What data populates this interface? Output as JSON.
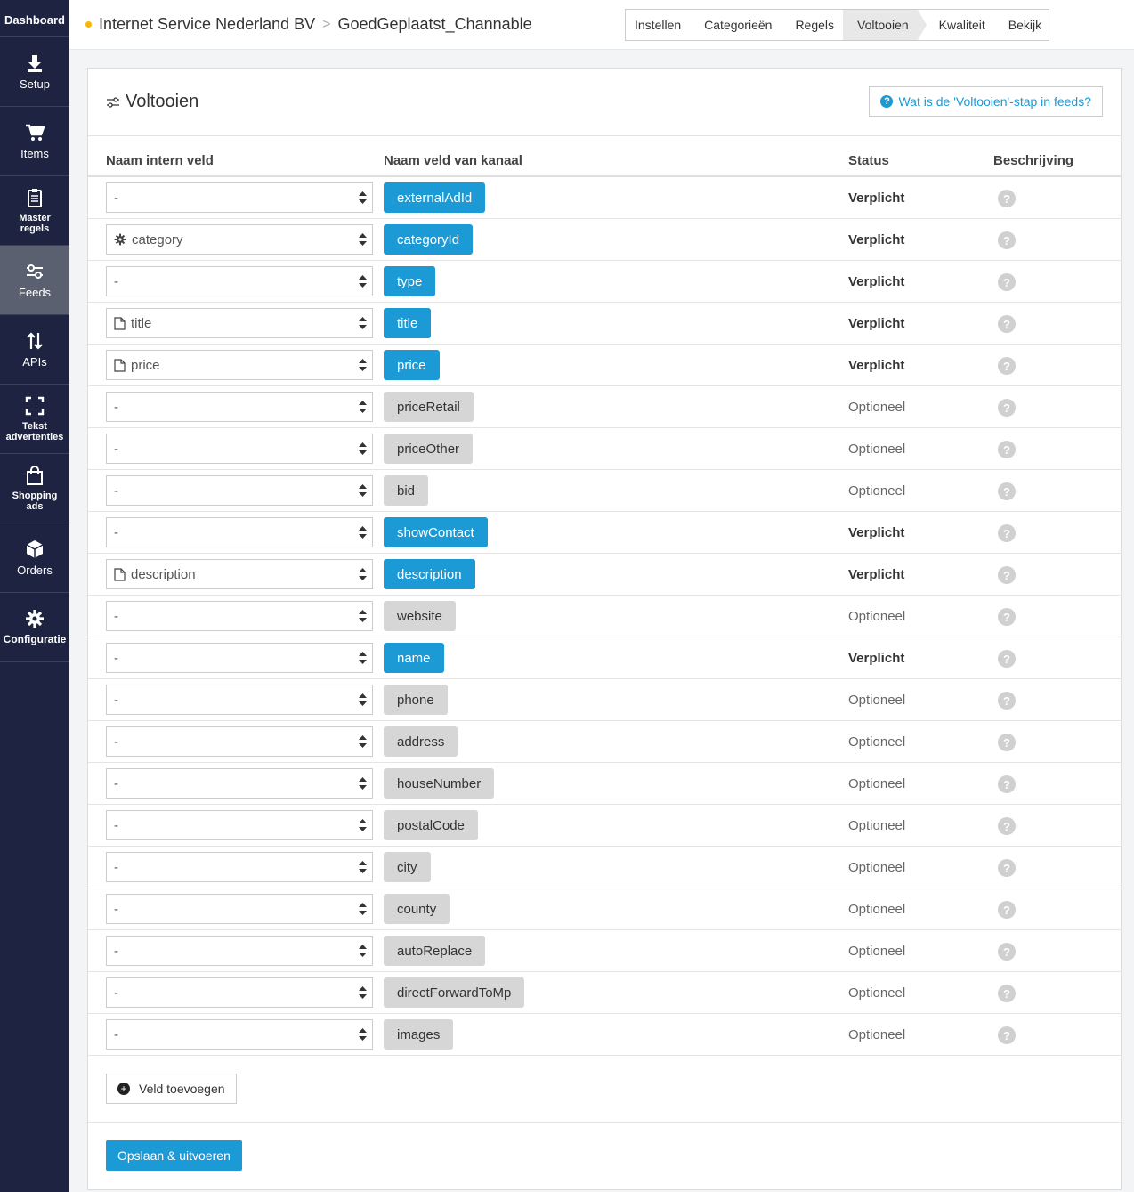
{
  "sidebar": {
    "items": [
      {
        "label": "Dashboard",
        "icon": "dashboard-icon"
      },
      {
        "label": "Setup",
        "icon": "download-icon"
      },
      {
        "label": "Items",
        "icon": "cart-icon"
      },
      {
        "label": "Master regels",
        "icon": "clipboard-icon"
      },
      {
        "label": "Feeds",
        "icon": "sliders-icon"
      },
      {
        "label": "APIs",
        "icon": "swap-icon"
      },
      {
        "label": "Tekst advertenties",
        "icon": "frame-icon"
      },
      {
        "label": "Shopping ads",
        "icon": "bag-icon"
      },
      {
        "label": "Orders",
        "icon": "box-icon"
      },
      {
        "label": "Configuratie",
        "icon": "gear-icon"
      }
    ]
  },
  "header": {
    "company": "Internet Service Nederland BV",
    "separator": ">",
    "feed": "GoedGeplaatst_Channable",
    "steps": [
      "Instellen",
      "Categorieën",
      "Regels",
      "Voltooien",
      "Kwaliteit",
      "Bekijk"
    ],
    "active_step": "Voltooien"
  },
  "panel": {
    "title": "Voltooien",
    "help_label": "Wat is de 'Voltooien'-stap in feeds?",
    "help_icon": "?",
    "columns": {
      "internal": "Naam intern veld",
      "channel": "Naam veld van kanaal",
      "status": "Status",
      "description": "Beschrijving"
    },
    "rows": [
      {
        "internal": "-",
        "icon": "",
        "channel": "externalAdId",
        "status": "Verplicht",
        "required": true
      },
      {
        "internal": "category",
        "icon": "gear",
        "channel": "categoryId",
        "status": "Verplicht",
        "required": true
      },
      {
        "internal": "-",
        "icon": "",
        "channel": "type",
        "status": "Verplicht",
        "required": true
      },
      {
        "internal": "title",
        "icon": "file",
        "channel": "title",
        "status": "Verplicht",
        "required": true
      },
      {
        "internal": "price",
        "icon": "file",
        "channel": "price",
        "status": "Verplicht",
        "required": true
      },
      {
        "internal": "-",
        "icon": "",
        "channel": "priceRetail",
        "status": "Optioneel",
        "required": false
      },
      {
        "internal": "-",
        "icon": "",
        "channel": "priceOther",
        "status": "Optioneel",
        "required": false
      },
      {
        "internal": "-",
        "icon": "",
        "channel": "bid",
        "status": "Optioneel",
        "required": false
      },
      {
        "internal": "-",
        "icon": "",
        "channel": "showContact",
        "status": "Verplicht",
        "required": true
      },
      {
        "internal": "description",
        "icon": "file",
        "channel": "description",
        "status": "Verplicht",
        "required": true
      },
      {
        "internal": "-",
        "icon": "",
        "channel": "website",
        "status": "Optioneel",
        "required": false
      },
      {
        "internal": "-",
        "icon": "",
        "channel": "name",
        "status": "Verplicht",
        "required": true
      },
      {
        "internal": "-",
        "icon": "",
        "channel": "phone",
        "status": "Optioneel",
        "required": false
      },
      {
        "internal": "-",
        "icon": "",
        "channel": "address",
        "status": "Optioneel",
        "required": false
      },
      {
        "internal": "-",
        "icon": "",
        "channel": "houseNumber",
        "status": "Optioneel",
        "required": false
      },
      {
        "internal": "-",
        "icon": "",
        "channel": "postalCode",
        "status": "Optioneel",
        "required": false
      },
      {
        "internal": "-",
        "icon": "",
        "channel": "city",
        "status": "Optioneel",
        "required": false
      },
      {
        "internal": "-",
        "icon": "",
        "channel": "county",
        "status": "Optioneel",
        "required": false
      },
      {
        "internal": "-",
        "icon": "",
        "channel": "autoReplace",
        "status": "Optioneel",
        "required": false
      },
      {
        "internal": "-",
        "icon": "",
        "channel": "directForwardToMp",
        "status": "Optioneel",
        "required": false
      },
      {
        "internal": "-",
        "icon": "",
        "channel": "images",
        "status": "Optioneel",
        "required": false
      }
    ],
    "add_field_label": "Veld toevoegen",
    "add_icon": "+",
    "save_label": "Opslaan & uitvoeren"
  },
  "colors": {
    "sidebar": "#1d2340",
    "accent": "#1b9ad6",
    "optional_chip": "#d6d6d6",
    "breadcrumb_dot": "#f6b800"
  }
}
